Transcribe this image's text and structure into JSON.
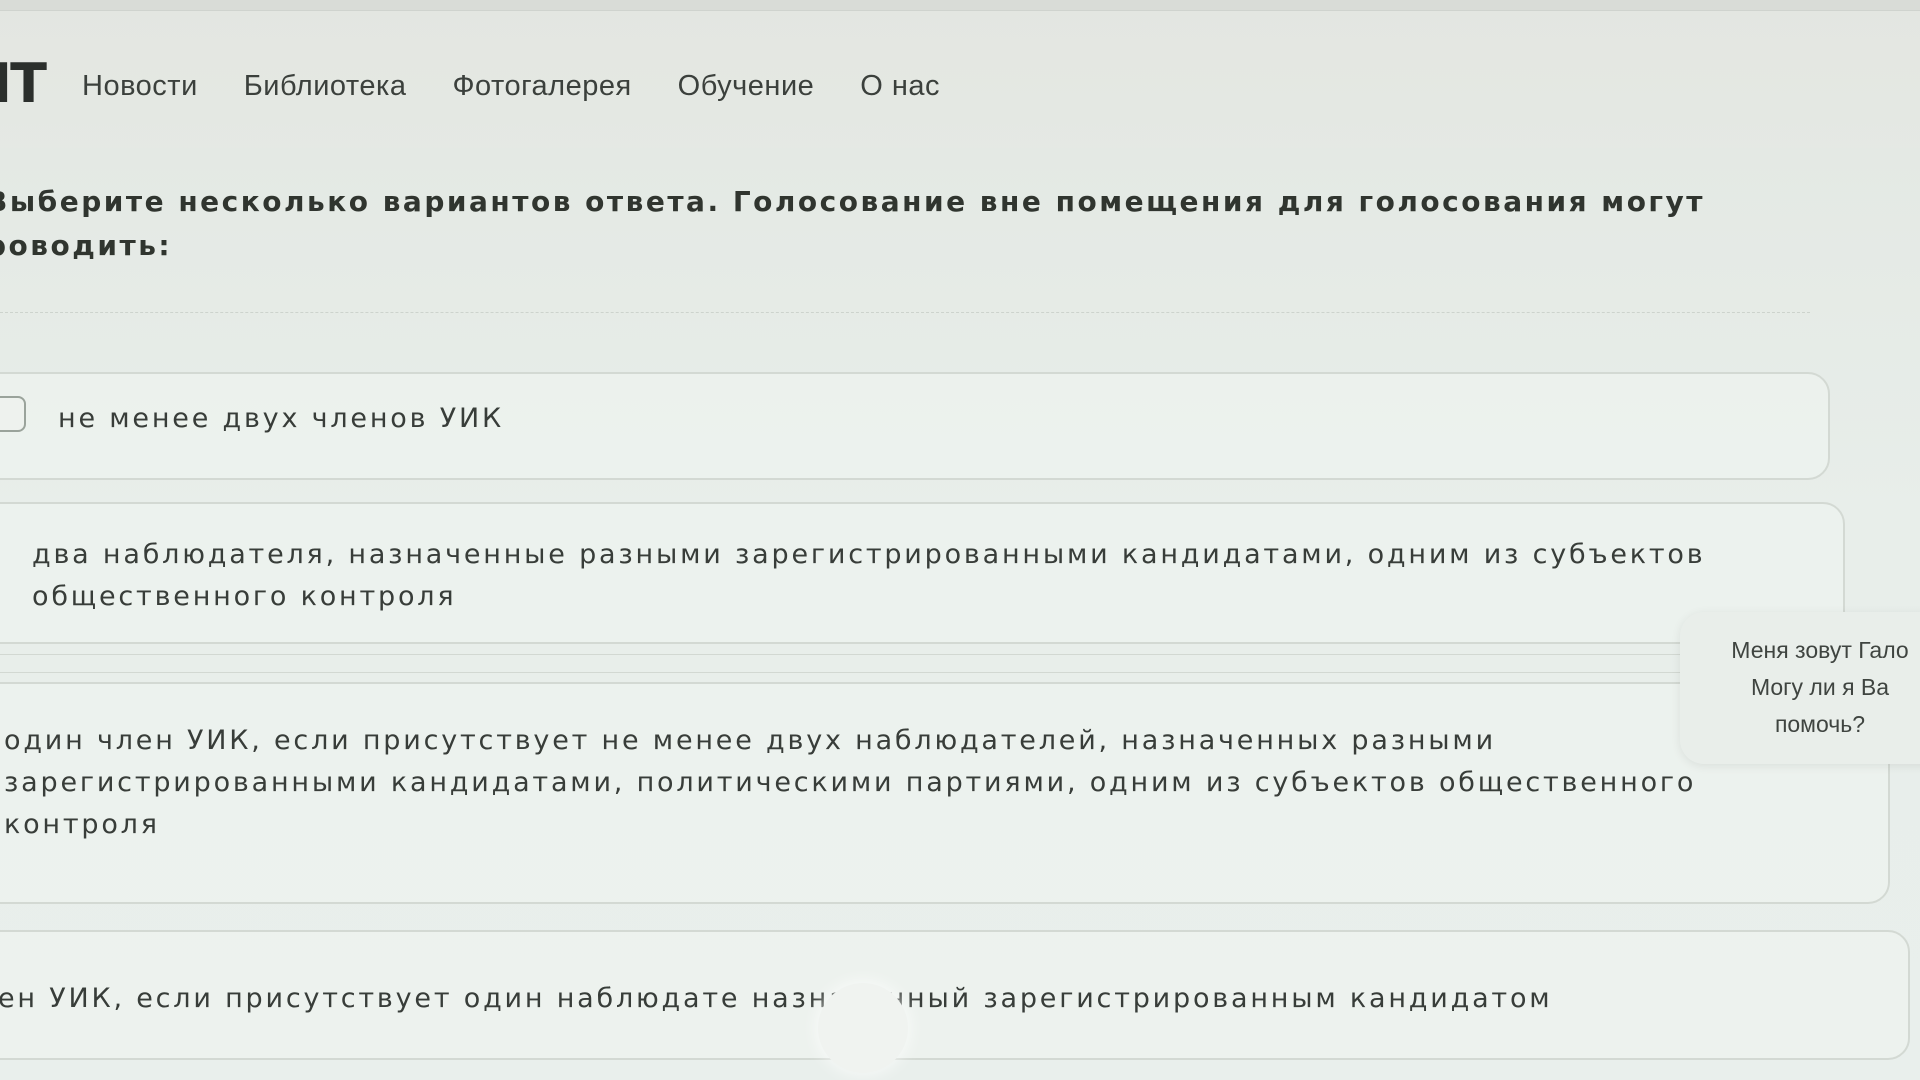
{
  "header": {
    "logo": "IT",
    "nav": [
      "Новости",
      "Библиотека",
      "Фотогалерея",
      "Обучение",
      "О нас"
    ]
  },
  "question": {
    "line1": "Выберите несколько вариантов ответа. Голосование вне помещения для голосования могут",
    "line2": "роводить:"
  },
  "options": [
    {
      "lines": [
        "не менее двух членов УИК"
      ],
      "checked": false
    },
    {
      "lines": [
        "два наблюдателя, назначенные разными зарегистрированными кандидатами, одним из субъектов",
        "общественного контроля"
      ]
    },
    {
      "lines": [
        "один член УИК, если присутствует не менее двух наблюдателей, назначенных разными",
        "зарегистрированными кандидатами, политическими партиями, одним из субъектов общественного",
        "контроля"
      ]
    },
    {
      "lines": [
        "ен УИК, если присутствует один наблюдате  назначенный зарегистрированным кандидатом"
      ]
    }
  ],
  "chat": {
    "lines": [
      "Меня зовут Гало",
      "Могу ли я Ва",
      "помочь?"
    ]
  },
  "colors": {
    "background": "#e8eee9",
    "text": "#383d39",
    "border": "#d3d9d3"
  }
}
